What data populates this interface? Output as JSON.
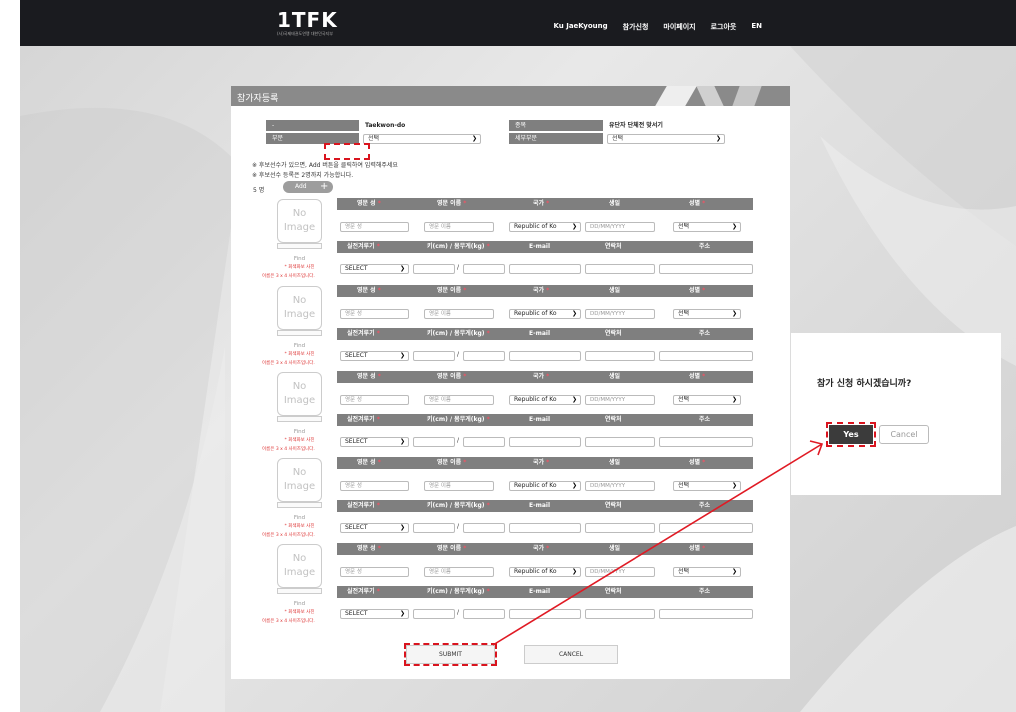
{
  "header": {
    "logo_text": "1TF",
    "logo_k": "K",
    "logo_sub": "(사)국제태권도연맹 대한민국지부",
    "nav": [
      "Ku JaeKyoung",
      "참가신청",
      "마이페이지",
      "로그아웃",
      "EN"
    ]
  },
  "panel": {
    "title": "참가자등록",
    "info_table": {
      "r1": {
        "label": "-",
        "value": "Taekwon-do",
        "label2": "종목",
        "value2": "유단자 단체전 맞서기"
      },
      "r2": {
        "label": "부문",
        "select": "선택",
        "label2": "세부부문",
        "select2": "선택"
      }
    },
    "notes": [
      "※ 후보선수가 있으면, Add 버튼을 클릭하여 입력해주세요",
      "※ 후보선수 등록은 2명까지 가능합니다."
    ],
    "count": "5 명",
    "add_label": "Add",
    "add_plus": "+",
    "photo": {
      "no": "No",
      "image": "Image",
      "find": "Find",
      "req1": "* 회색화보 사진",
      "req2": "이름은 3 x 4 사이즈입니다."
    },
    "headers1": [
      "영문 성",
      "영문 이름",
      "국가",
      "생일",
      "성별"
    ],
    "headers2": [
      "실전겨루기",
      "키(cm) / 몸무게(kg)",
      "E-mail",
      "연락처",
      "주소"
    ],
    "required_mark": "*",
    "placeholders": {
      "last": "영문 성",
      "first": "영문 이름",
      "country": "Republic of Ko",
      "dob": "DD/MM/YYYY",
      "gender": "선택",
      "sparring": "SELECT",
      "slash": "/"
    },
    "submit": "SUBMIT",
    "cancel": "CANCEL"
  },
  "dialog": {
    "question": "참가 신청 하시겠습니까?",
    "yes": "Yes",
    "cancel": "Cancel"
  },
  "colors": {
    "topbar": "#1a1b1f",
    "header_gray": "#7f7f7f",
    "annotation_red": "#d9141e",
    "primary_button": "#3b3b3b"
  }
}
